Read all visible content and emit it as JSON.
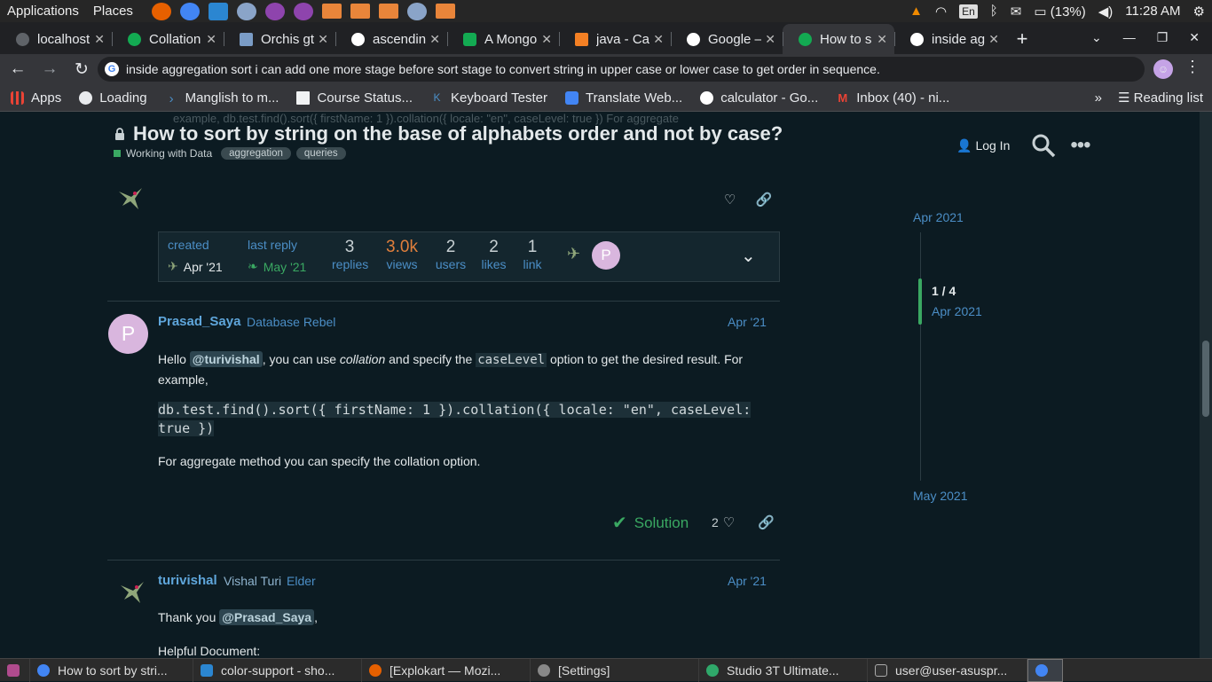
{
  "system_bar": {
    "applications": "Applications",
    "places": "Places",
    "lang": "En",
    "battery": "(13%)",
    "time": "11:28 AM"
  },
  "tabs": [
    {
      "label": "localhost",
      "color": "#5f6368"
    },
    {
      "label": "Collation",
      "color": "#13aa52"
    },
    {
      "label": "Orchis gt",
      "color": "#7a9cc6"
    },
    {
      "label": "ascendin",
      "color": "#ffffff"
    },
    {
      "label": "A Mongo",
      "color": "#13aa52"
    },
    {
      "label": "java - Cas",
      "color": "#f48024"
    },
    {
      "label": "Google –",
      "color": "#ffffff"
    },
    {
      "label": "How to s",
      "color": "#13aa52"
    },
    {
      "label": "inside ag",
      "color": "#ffffff"
    }
  ],
  "omnibox": {
    "url": "inside aggregation sort i can add one more stage before sort stage to convert string in upper case or lower case to get order in sequence."
  },
  "bookmarks": {
    "items": [
      {
        "label": "Apps"
      },
      {
        "label": "Loading"
      },
      {
        "label": "Manglish to m..."
      },
      {
        "label": "Course Status..."
      },
      {
        "label": "Keyboard Tester"
      },
      {
        "label": "Translate Web..."
      },
      {
        "label": "calculator - Go..."
      },
      {
        "label": "Inbox (40) - ni..."
      }
    ],
    "more": "»",
    "reading_list": "Reading list"
  },
  "topic": {
    "faded_line": "example, db.test.find().sort({ firstName: 1 }).collation({ locale: \"en\", caseLevel: true }) For aggregate",
    "title": "How to sort by string on the base of alphabets order and not by case?",
    "category": "Working with Data",
    "tags": [
      "aggregation",
      "queries"
    ]
  },
  "header": {
    "login": "Log In"
  },
  "stats": {
    "created_label": "created",
    "created_date": "Apr '21",
    "last_reply_label": "last reply",
    "last_reply_date": "May '21",
    "replies": "3",
    "replies_label": "replies",
    "views": "3.0k",
    "views_label": "views",
    "users": "2",
    "users_label": "users",
    "likes": "2",
    "likes_label": "likes",
    "links": "1",
    "links_label": "link",
    "participant_initial": "P"
  },
  "post1": {
    "initial": "P",
    "username": "Prasad_Saya",
    "user_title": "Database Rebel",
    "date": "Apr '21",
    "p1_hello": "Hello",
    "p1_mention": "@turivishal",
    "p1_mid": ", you can use",
    "p1_em": "collation",
    "p1_and": "and specify the",
    "p1_code": "caseLevel",
    "p1_end": "option to get the desired result. For example,",
    "code_line1": "db.test.find().sort({ firstName: 1 }).collation({ locale: \"en\", caseLevel:",
    "code_line2": "true })",
    "p2": "For aggregate method you can specify the collation option.",
    "solution": "Solution",
    "like_count": "2"
  },
  "post2": {
    "username": "turivishal",
    "fullname": "Vishal Turi",
    "user_title": "Elder",
    "date": "Apr '21",
    "thanks": "Thank you",
    "mention": "@Prasad_Saya",
    "comma": ",",
    "helpful": "Helpful Document:"
  },
  "timeline": {
    "top": "Apr 2021",
    "count": "1 / 4",
    "mid": "Apr 2021",
    "bottom": "May 2021"
  },
  "taskbar": [
    {
      "label": "How to sort by stri..."
    },
    {
      "label": "color-support - sho..."
    },
    {
      "label": "[Explokart — Mozi..."
    },
    {
      "label": "[Settings]"
    },
    {
      "label": "Studio 3T Ultimate..."
    },
    {
      "label": "user@user-asuspr..."
    }
  ]
}
